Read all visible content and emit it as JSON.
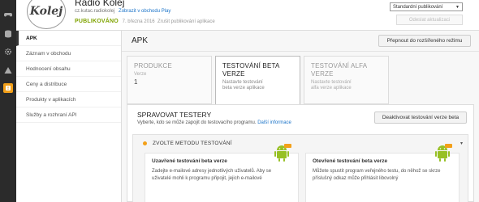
{
  "rail": {
    "icons": [
      "gamepad-icon",
      "database-icon",
      "gear-icon",
      "warning-icon",
      "alert-icon"
    ]
  },
  "header": {
    "app_name": "Rádio Kolej",
    "logo_text": "Kolej",
    "package": "cz.kutac.radiokolej",
    "play_link": "Zobrazit v obchodu Play",
    "status": "PUBLIKOVÁNO",
    "date": "7. března 2016",
    "unpublish": "Zrušit publikování aplikace",
    "language": "Standardní publikování",
    "send_update": "Odeslat aktualizaci"
  },
  "sidebar": {
    "items": [
      {
        "label": "APK",
        "active": true
      },
      {
        "label": "Záznam v obchodu"
      },
      {
        "label": "Hodnocení obsahu"
      },
      {
        "label": "Ceny a distribuce"
      },
      {
        "label": "Produkty v aplikacích"
      },
      {
        "label": "Služby a rozhraní API"
      }
    ]
  },
  "main": {
    "title": "APK",
    "advanced_mode": "Přepnout do rozšířeného režimu",
    "tabs": [
      {
        "title": "PRODUKCE",
        "sub": "Verze",
        "num": "1"
      },
      {
        "title1": "TESTOVÁNÍ BETA",
        "title2": "VERZE",
        "sub1": "Nastavte testování",
        "sub2": "beta verze aplikace"
      },
      {
        "title1": "TESTOVÁNÍ ALFA",
        "title2": "VERZE",
        "sub1": "Nastavte testování",
        "sub2": "alfa verze aplikace"
      }
    ],
    "manage_title": "SPRAVOVAT TESTERY",
    "manage_sub": "Vyberte, kdo se může zapojit do testovacího programu.",
    "more_info": "Další informace",
    "deactivate": "Deaktivovat testování verze beta",
    "method_label": "ZVOLTE METODU TESTOVÁNÍ",
    "options": [
      {
        "title": "Uzavřené testování beta verze",
        "desc": "Zadejte e-mailové adresy jednotlivých uživatelů. Aby se uživatelé mohli k programu připojit, jejich e-mailové"
      },
      {
        "title": "Otevřené testování beta verze",
        "desc": "Můžete spustit program veřejného testu, do něhož se skrze příslušný odkaz může přihlásit libovolný"
      }
    ]
  },
  "colors": {
    "accent": "#f3a019",
    "published": "#7fa300",
    "link": "#1a73c8",
    "rail": "#2b2b2b",
    "android": "#97c024"
  }
}
